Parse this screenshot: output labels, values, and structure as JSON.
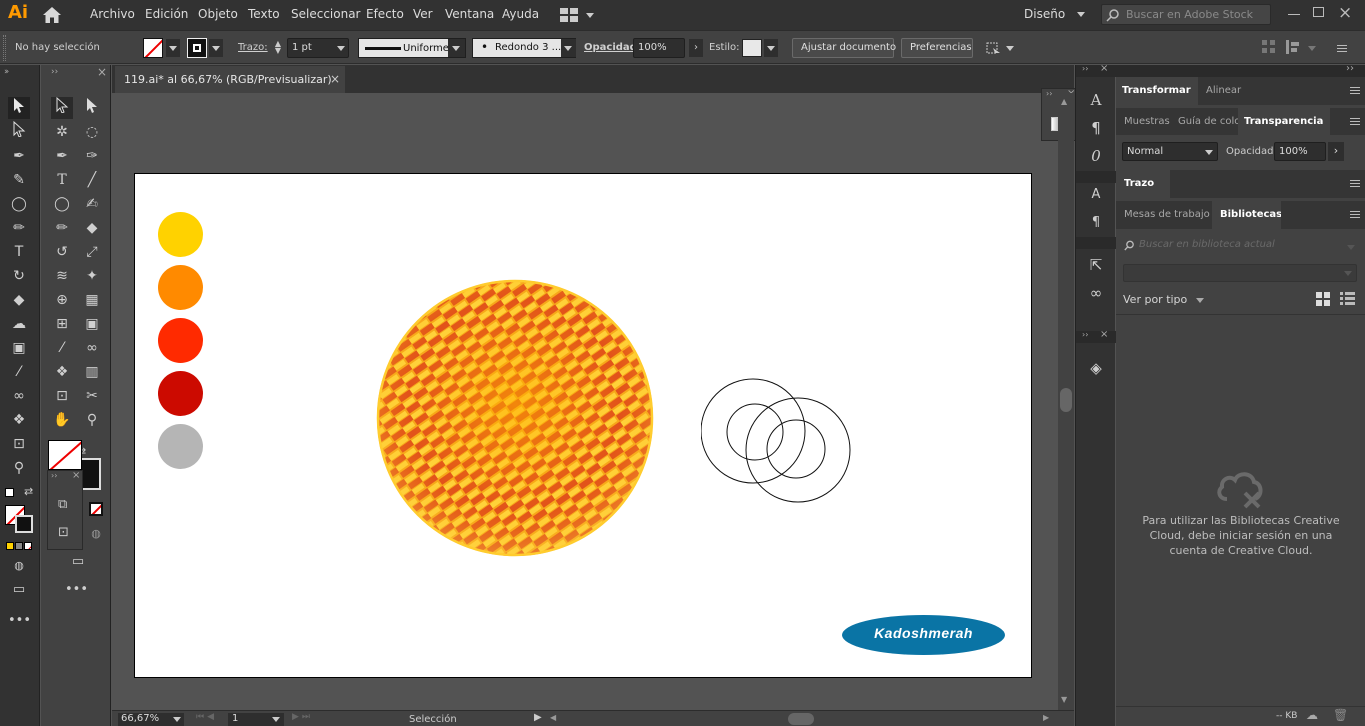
{
  "app": {
    "logo": "Ai"
  },
  "menu": [
    "Archivo",
    "Edición",
    "Objeto",
    "Texto",
    "Seleccionar",
    "Efecto",
    "Ver",
    "Ventana",
    "Ayuda"
  ],
  "workspace": "Diseño",
  "stock_search": {
    "placeholder": "Buscar en Adobe Stock"
  },
  "control": {
    "selection": "No hay selección",
    "stroke_label": "Trazo:",
    "stroke_weight": "1 pt",
    "profile": "Uniforme",
    "brush": "Redondo 3 ...",
    "opacity_label": "Opacidad:",
    "opacity": "100%",
    "style_label": "Estilo:",
    "fit_button": "Ajustar documento",
    "prefs_button": "Preferencias"
  },
  "document": {
    "tab": "119.ai* al 66,67% (RGB/Previsualizar)",
    "close": "×"
  },
  "artwork": {
    "swatches": [
      "#ffd200",
      "#ff8a00",
      "#ff2a00",
      "#cc0a00",
      "#b5b5b5"
    ],
    "pattern_colors": {
      "base": "#f7a71a",
      "stripe_dark": "#e2531a",
      "stripe_light": "#ffd23a",
      "rim": "#ffcc2e"
    },
    "logo_text": "Kadoshmerah",
    "logo_color": "#0a74a5"
  },
  "status": {
    "zoom": "66,67%",
    "page": "1",
    "tool": "Selección"
  },
  "panels": {
    "tab_transform": "Transformar",
    "tab_align": "Alinear",
    "tab_swatches": "Muestras",
    "tab_guide": "Guía de colo",
    "tab_transparency": "Transparencia",
    "blend_mode": "Normal",
    "opacity_label": "Opacidad:",
    "opacity": "100%",
    "tab_stroke": "Trazo",
    "tab_artboards": "Mesas de trabajo",
    "tab_libraries": "Bibliotecas",
    "library_search_placeholder": "Buscar en biblioteca actual",
    "view_by": "Ver por tipo",
    "message": "Para utilizar las Bibliotecas Creative Cloud, debe iniciar sesión en una cuenta de Creative Cloud.",
    "size": "-- KB"
  }
}
